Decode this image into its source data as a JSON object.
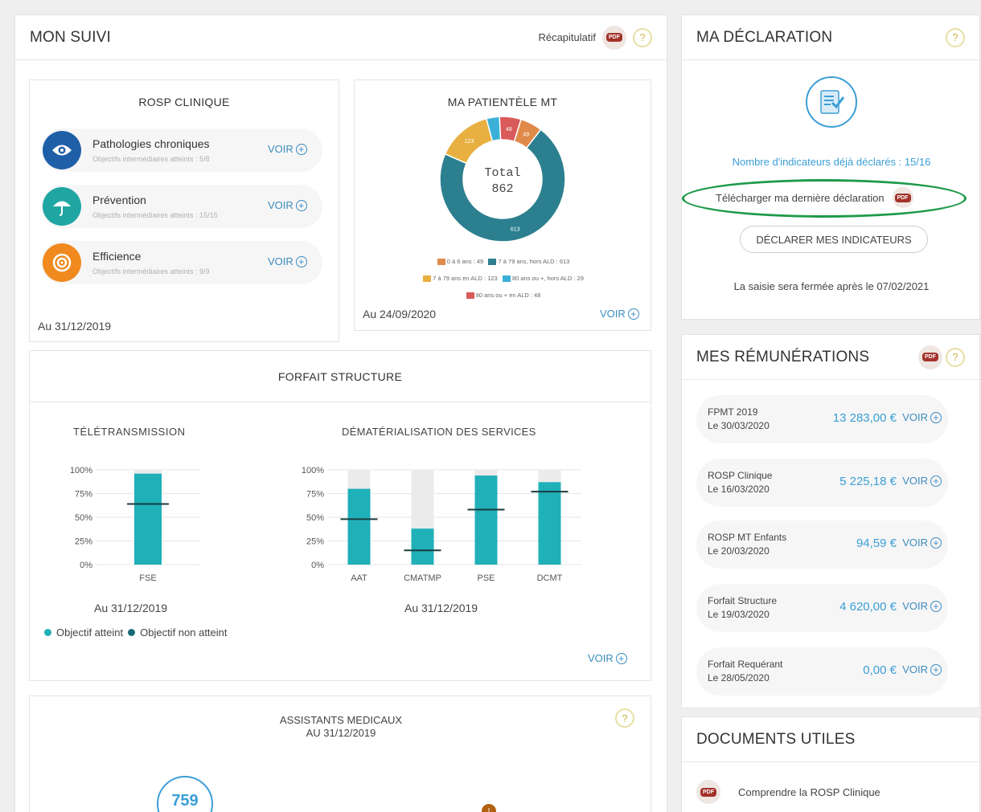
{
  "mon_suivi": {
    "title": "MON SUIVI",
    "recap_label": "Récapitulatif",
    "pdf_label": "PDF",
    "help": "?"
  },
  "rosp": {
    "title": "ROSP CLINIQUE",
    "items": [
      {
        "name": "Pathologies chroniques",
        "sub": "Objectifs intermédiaires atteints : 5/8",
        "voir": "VOIR",
        "color": "#1f5fa8",
        "icon": "eye-icon"
      },
      {
        "name": "Prévention",
        "sub": "Objectifs intermédiaires atteints : 15/15",
        "voir": "VOIR",
        "color": "#1fa6a3",
        "icon": "umbrella-icon"
      },
      {
        "name": "Efficience",
        "sub": "Objectifs intermédiaires atteints : 9/9",
        "voir": "VOIR",
        "color": "#f08a1f",
        "icon": "target-icon"
      }
    ],
    "date": "Au 31/12/2019"
  },
  "patientele": {
    "title": "MA PATIENTÈLE MT",
    "total_label": "Total",
    "total_value": "862",
    "legend": [
      {
        "label": "0 à 6 ans : 49",
        "color": "#e08a4a"
      },
      {
        "label": "7 à 79 ans, hors ALD : 613",
        "color": "#2c7f8f"
      },
      {
        "label": "7 à 79 ans en ALD : 123",
        "color": "#e8b040"
      },
      {
        "label": "80 ans ou +, hors ALD : 29",
        "color": "#3bb0d8"
      },
      {
        "label": "80 ans ou + en ALD : 48",
        "color": "#d95a5a"
      }
    ],
    "date": "Au 24/09/2020",
    "voir": "VOIR"
  },
  "forfait": {
    "title": "FORFAIT STRUCTURE",
    "teletrans_title": "TÉLÉTRANSMISSION",
    "demat_title": "DÉMATÉRIALISATION DES SERVICES",
    "teletrans_date": "Au 31/12/2019",
    "demat_date": "Au 31/12/2019",
    "legend_atteint": "Objectif atteint",
    "legend_non_atteint": "Objectif non atteint",
    "voir": "VOIR"
  },
  "chart_data": [
    {
      "type": "bar",
      "title": "TÉLÉTRANSMISSION",
      "categories": [
        "FSE"
      ],
      "values": [
        96
      ],
      "targets": [
        64
      ],
      "ylim": [
        0,
        100
      ],
      "yticks": [
        "0%",
        "25%",
        "50%",
        "75%",
        "100%"
      ],
      "bar_color": "#1fb0b8"
    },
    {
      "type": "bar",
      "title": "DÉMATÉRIALISATION DES SERVICES",
      "categories": [
        "AAT",
        "CMATMP",
        "PSE",
        "DCMT"
      ],
      "values": [
        80,
        38,
        94,
        87
      ],
      "targets": [
        48,
        15,
        58,
        77
      ],
      "ylim": [
        0,
        100
      ],
      "yticks": [
        "0%",
        "25%",
        "50%",
        "75%",
        "100%"
      ],
      "bar_color": "#1fb0b8"
    },
    {
      "type": "pie",
      "title": "MA PATIENTÈLE MT",
      "labels": [
        "0 à 6 ans",
        "7 à 79 ans, hors ALD",
        "7 à 79 ans en ALD",
        "80 ans ou +, hors ALD",
        "80 ans ou + en ALD"
      ],
      "values": [
        49,
        613,
        123,
        29,
        48
      ],
      "slice_labels": [
        "49",
        "613",
        "123",
        "",
        "48"
      ]
    }
  ],
  "assistants": {
    "title_line1": "ASSISTANTS MEDICAUX",
    "title_line2": "AU 31/12/2019",
    "value": "759",
    "help": "?"
  },
  "declaration": {
    "title": "MA DÉCLARATION",
    "help": "?",
    "indicators_text": "Nombre d'indicateurs déjà déclarés : 15/16",
    "download_text": "Télécharger ma dernière déclaration",
    "declare_button": "DÉCLARER MES INDICATEURS",
    "closing_text": "La saisie sera fermée après le 07/02/2021"
  },
  "remunerations": {
    "title": "MES RÉMUNÉRATIONS",
    "items": [
      {
        "line1": "FPMT 2019",
        "line2": "Le 30/03/2020",
        "amount": "13 283,00 €",
        "voir": "VOIR"
      },
      {
        "line1": "ROSP Clinique",
        "line2": "Le 16/03/2020",
        "amount": "5 225,18 €",
        "voir": "VOIR"
      },
      {
        "line1": "ROSP MT Enfants",
        "line2": "Le 20/03/2020",
        "amount": "94,59 €",
        "voir": "VOIR"
      },
      {
        "line1": "Forfait Structure",
        "line2": "Le 19/03/2020",
        "amount": "4 620,00 €",
        "voir": "VOIR"
      },
      {
        "line1": "Forfait Requérant",
        "line2": "Le 28/05/2020",
        "amount": "0,00 €",
        "voir": "VOIR"
      }
    ]
  },
  "documents": {
    "title": "DOCUMENTS UTILES",
    "items": [
      {
        "label": "Comprendre la ROSP Clinique"
      }
    ]
  }
}
